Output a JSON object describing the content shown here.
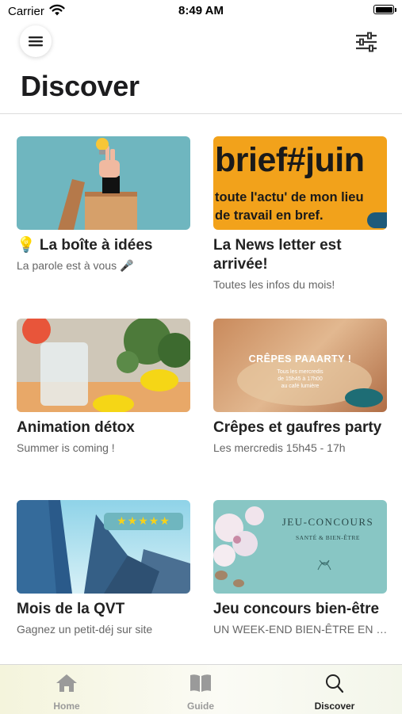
{
  "status_bar": {
    "carrier": "Carrier",
    "time": "8:49 AM"
  },
  "header": {
    "title": "Discover",
    "menu_icon": "hamburger-icon",
    "filter_icon": "sliders-icon"
  },
  "cards": [
    {
      "title": "💡 La boîte à idées",
      "subtitle": "La parole est à vous 🎤"
    },
    {
      "title": "La News letter est arrivée!",
      "subtitle": "Toutes les infos du mois!",
      "image_text": {
        "headline": "brief#juin",
        "line1": "toute l'actu' de mon lieu",
        "line2": "de travail en bref."
      }
    },
    {
      "title": "Animation détox",
      "subtitle": "Summer is coming !"
    },
    {
      "title": "Crêpes et gaufres party",
      "subtitle": "Les mercredis 15h45 - 17h",
      "image_text": {
        "headline": "CRÊPES PAAARTY !",
        "line1": "Tous les mercredis",
        "line2": "de 15h45 à 17h00",
        "line3": "au café lumière"
      }
    },
    {
      "title": "Mois de la QVT",
      "subtitle": "Gagnez un petit-déj sur site",
      "rating": 5,
      "rating_stars": "★★★★★"
    },
    {
      "title": "Jeu concours bien-être",
      "subtitle": "UN WEEK-END BIEN-ÊTRE EN DUO",
      "image_text": {
        "headline": "JEU-CONCOURS",
        "line1": "SANTÉ & BIEN-ÊTRE"
      }
    }
  ],
  "tabs": [
    {
      "label": "Home",
      "icon": "home-icon"
    },
    {
      "label": "Guide",
      "icon": "book-icon"
    },
    {
      "label": "Discover",
      "icon": "search-icon"
    }
  ],
  "active_tab": "Discover",
  "colors": {
    "accent_yellow": "#f2a21b",
    "teal": "#6fb6bf",
    "active_tab": "#222222",
    "inactive_tab": "#9a9a9a"
  }
}
